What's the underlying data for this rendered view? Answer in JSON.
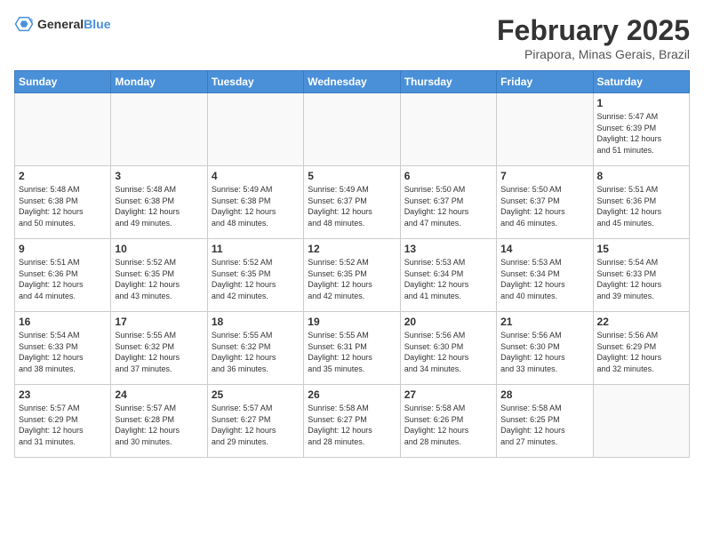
{
  "header": {
    "logo_general": "General",
    "logo_blue": "Blue",
    "main_title": "February 2025",
    "sub_title": "Pirapora, Minas Gerais, Brazil"
  },
  "weekdays": [
    "Sunday",
    "Monday",
    "Tuesday",
    "Wednesday",
    "Thursday",
    "Friday",
    "Saturday"
  ],
  "weeks": [
    [
      {
        "day": "",
        "info": ""
      },
      {
        "day": "",
        "info": ""
      },
      {
        "day": "",
        "info": ""
      },
      {
        "day": "",
        "info": ""
      },
      {
        "day": "",
        "info": ""
      },
      {
        "day": "",
        "info": ""
      },
      {
        "day": "1",
        "info": "Sunrise: 5:47 AM\nSunset: 6:39 PM\nDaylight: 12 hours\nand 51 minutes."
      }
    ],
    [
      {
        "day": "2",
        "info": "Sunrise: 5:48 AM\nSunset: 6:38 PM\nDaylight: 12 hours\nand 50 minutes."
      },
      {
        "day": "3",
        "info": "Sunrise: 5:48 AM\nSunset: 6:38 PM\nDaylight: 12 hours\nand 49 minutes."
      },
      {
        "day": "4",
        "info": "Sunrise: 5:49 AM\nSunset: 6:38 PM\nDaylight: 12 hours\nand 48 minutes."
      },
      {
        "day": "5",
        "info": "Sunrise: 5:49 AM\nSunset: 6:37 PM\nDaylight: 12 hours\nand 48 minutes."
      },
      {
        "day": "6",
        "info": "Sunrise: 5:50 AM\nSunset: 6:37 PM\nDaylight: 12 hours\nand 47 minutes."
      },
      {
        "day": "7",
        "info": "Sunrise: 5:50 AM\nSunset: 6:37 PM\nDaylight: 12 hours\nand 46 minutes."
      },
      {
        "day": "8",
        "info": "Sunrise: 5:51 AM\nSunset: 6:36 PM\nDaylight: 12 hours\nand 45 minutes."
      }
    ],
    [
      {
        "day": "9",
        "info": "Sunrise: 5:51 AM\nSunset: 6:36 PM\nDaylight: 12 hours\nand 44 minutes."
      },
      {
        "day": "10",
        "info": "Sunrise: 5:52 AM\nSunset: 6:35 PM\nDaylight: 12 hours\nand 43 minutes."
      },
      {
        "day": "11",
        "info": "Sunrise: 5:52 AM\nSunset: 6:35 PM\nDaylight: 12 hours\nand 42 minutes."
      },
      {
        "day": "12",
        "info": "Sunrise: 5:52 AM\nSunset: 6:35 PM\nDaylight: 12 hours\nand 42 minutes."
      },
      {
        "day": "13",
        "info": "Sunrise: 5:53 AM\nSunset: 6:34 PM\nDaylight: 12 hours\nand 41 minutes."
      },
      {
        "day": "14",
        "info": "Sunrise: 5:53 AM\nSunset: 6:34 PM\nDaylight: 12 hours\nand 40 minutes."
      },
      {
        "day": "15",
        "info": "Sunrise: 5:54 AM\nSunset: 6:33 PM\nDaylight: 12 hours\nand 39 minutes."
      }
    ],
    [
      {
        "day": "16",
        "info": "Sunrise: 5:54 AM\nSunset: 6:33 PM\nDaylight: 12 hours\nand 38 minutes."
      },
      {
        "day": "17",
        "info": "Sunrise: 5:55 AM\nSunset: 6:32 PM\nDaylight: 12 hours\nand 37 minutes."
      },
      {
        "day": "18",
        "info": "Sunrise: 5:55 AM\nSunset: 6:32 PM\nDaylight: 12 hours\nand 36 minutes."
      },
      {
        "day": "19",
        "info": "Sunrise: 5:55 AM\nSunset: 6:31 PM\nDaylight: 12 hours\nand 35 minutes."
      },
      {
        "day": "20",
        "info": "Sunrise: 5:56 AM\nSunset: 6:30 PM\nDaylight: 12 hours\nand 34 minutes."
      },
      {
        "day": "21",
        "info": "Sunrise: 5:56 AM\nSunset: 6:30 PM\nDaylight: 12 hours\nand 33 minutes."
      },
      {
        "day": "22",
        "info": "Sunrise: 5:56 AM\nSunset: 6:29 PM\nDaylight: 12 hours\nand 32 minutes."
      }
    ],
    [
      {
        "day": "23",
        "info": "Sunrise: 5:57 AM\nSunset: 6:29 PM\nDaylight: 12 hours\nand 31 minutes."
      },
      {
        "day": "24",
        "info": "Sunrise: 5:57 AM\nSunset: 6:28 PM\nDaylight: 12 hours\nand 30 minutes."
      },
      {
        "day": "25",
        "info": "Sunrise: 5:57 AM\nSunset: 6:27 PM\nDaylight: 12 hours\nand 29 minutes."
      },
      {
        "day": "26",
        "info": "Sunrise: 5:58 AM\nSunset: 6:27 PM\nDaylight: 12 hours\nand 28 minutes."
      },
      {
        "day": "27",
        "info": "Sunrise: 5:58 AM\nSunset: 6:26 PM\nDaylight: 12 hours\nand 28 minutes."
      },
      {
        "day": "28",
        "info": "Sunrise: 5:58 AM\nSunset: 6:25 PM\nDaylight: 12 hours\nand 27 minutes."
      },
      {
        "day": "",
        "info": ""
      }
    ]
  ]
}
